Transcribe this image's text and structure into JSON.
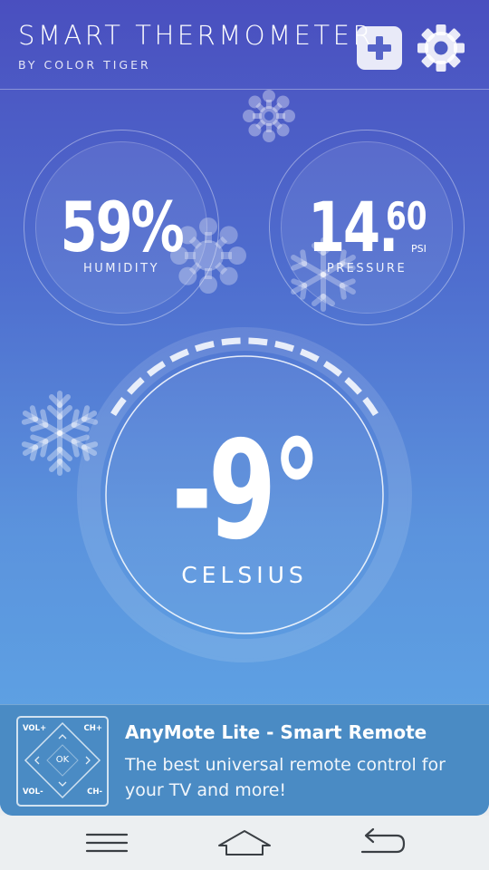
{
  "header": {
    "title": "SMART THERMOMETER",
    "subtitle": "BY COLOR TIGER",
    "add_icon": "plus-icon",
    "settings_icon": "gear-icon"
  },
  "humidity": {
    "value": "59%",
    "label": "HUMIDITY"
  },
  "pressure": {
    "value_int": "14.",
    "value_dec": "60",
    "unit": "PSI",
    "label": "PRESSURE"
  },
  "temperature": {
    "value": "-9°",
    "unit": "CELSIUS",
    "gauge_level_fraction": 0.33
  },
  "ad": {
    "icon": "remote-control-icon",
    "icon_labels": {
      "vol_plus": "VOL+",
      "ch_plus": "CH+",
      "ok": "OK",
      "vol_minus": "VOL-",
      "ch_minus": "CH-"
    },
    "title": "AnyMote Lite - Smart Remote",
    "description": "The best universal remote control for your TV and more!"
  },
  "navbar": {
    "menu_icon": "menu-icon",
    "home_icon": "home-icon",
    "back_icon": "back-icon"
  },
  "colors": {
    "bg_top": "#4a4fbf",
    "bg_bottom": "#5fa8e6",
    "ad_bg": "#4a8bc4",
    "navbar_bg": "#eceff1"
  }
}
